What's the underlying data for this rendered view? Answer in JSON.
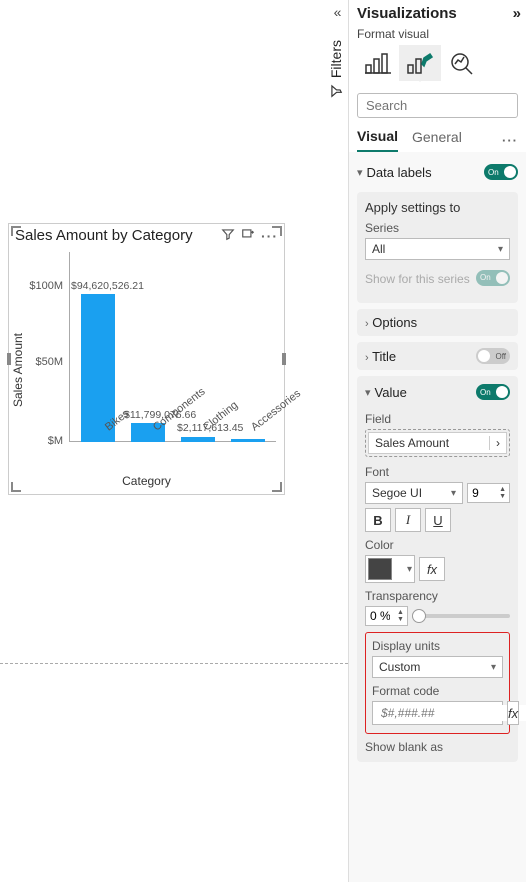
{
  "chart_data": {
    "type": "bar",
    "title": "Sales Amount by Category",
    "xlabel": "Category",
    "ylabel": "Sales Amount",
    "ylim": [
      0,
      100000000
    ],
    "y_ticks": [
      "$M",
      "$50M",
      "$100M"
    ],
    "categories": [
      "Bikes",
      "Components",
      "Clothing",
      "Accessories"
    ],
    "values": [
      94620526.21,
      11799076.66,
      2117613.45,
      1100000
    ],
    "data_labels": [
      "$94,620,526.21",
      "$11,799,076.66",
      "$2,117,613.45",
      ""
    ]
  },
  "filters_label": "Filters",
  "panel": {
    "title": "Visualizations",
    "subtitle": "Format visual",
    "search_placeholder": "Search",
    "tabs": {
      "visual": "Visual",
      "general": "General"
    },
    "data_labels": {
      "label": "Data labels",
      "toggle": "On"
    },
    "apply": {
      "title": "Apply settings to",
      "series_label": "Series",
      "series_value": "All",
      "show_for_series": "Show for this series",
      "show_for_series_toggle": "On"
    },
    "options": "Options",
    "title_section": {
      "label": "Title",
      "toggle": "Off"
    },
    "value_section": {
      "label": "Value",
      "toggle": "On",
      "field_label": "Field",
      "field_value": "Sales Amount",
      "font_label": "Font",
      "font_value": "Segoe UI",
      "font_size": "9",
      "bold": "B",
      "italic": "I",
      "underline": "U",
      "color_label": "Color",
      "fx": "fx",
      "transparency_label": "Transparency",
      "transparency_value": "0 %",
      "display_units_label": "Display units",
      "display_units_value": "Custom",
      "format_code_label": "Format code",
      "format_code_value": "$#,###.##",
      "show_blank": "Show blank as"
    }
  }
}
